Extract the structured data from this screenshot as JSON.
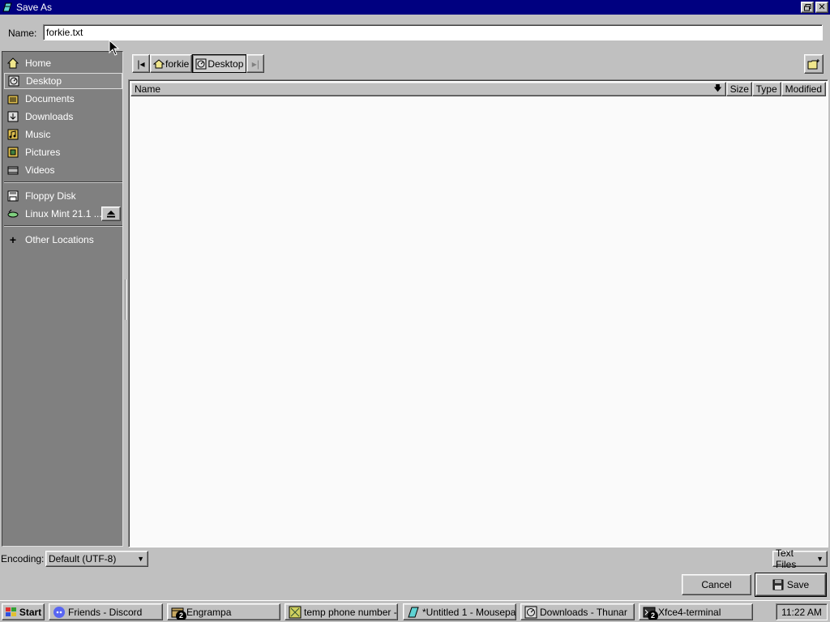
{
  "window": {
    "title": "Save As",
    "icon": "mousepad-icon"
  },
  "name_field": {
    "label": "Name:",
    "value": "forkie.txt"
  },
  "sidebar": {
    "items": [
      {
        "label": "Home",
        "icon": "home-icon",
        "selected": false
      },
      {
        "label": "Desktop",
        "icon": "desktop-icon",
        "selected": true
      },
      {
        "label": "Documents",
        "icon": "documents-icon",
        "selected": false
      },
      {
        "label": "Downloads",
        "icon": "downloads-icon",
        "selected": false
      },
      {
        "label": "Music",
        "icon": "music-icon",
        "selected": false
      },
      {
        "label": "Pictures",
        "icon": "pictures-icon",
        "selected": false
      },
      {
        "label": "Videos",
        "icon": "videos-icon",
        "selected": false
      }
    ],
    "devices": [
      {
        "label": "Floppy Disk",
        "icon": "floppy-disk-icon"
      },
      {
        "label": "Linux Mint 21.1 ...",
        "icon": "drive-icon"
      }
    ],
    "other": {
      "label": "Other Locations",
      "icon": "plus-icon"
    }
  },
  "path_bar": {
    "segments": [
      {
        "label": "forkie",
        "icon": "home-folder-icon",
        "active": false
      },
      {
        "label": "Desktop",
        "icon": "desktop-icon",
        "active": true
      }
    ]
  },
  "file_list": {
    "columns": {
      "name": "Name",
      "size": "Size",
      "type": "Type",
      "modified": "Modified"
    },
    "rows": []
  },
  "encoding": {
    "label": "Encoding:",
    "value": "Default (UTF-8)"
  },
  "filter": {
    "value": "Text Files"
  },
  "buttons": {
    "cancel": "Cancel",
    "save": "Save"
  },
  "taskbar": {
    "start_label": "Start",
    "tasks": [
      {
        "label": "Friends - Discord",
        "icon": "discord-icon",
        "badge": ""
      },
      {
        "label": "Engrampa",
        "icon": "archive-icon",
        "badge": "2"
      },
      {
        "label": "temp phone number - ...",
        "icon": "browser-icon",
        "badge": ""
      },
      {
        "label": "*Untitled 1 - Mousepad",
        "icon": "mousepad-icon",
        "badge": ""
      },
      {
        "label": "Downloads - Thunar",
        "icon": "thunar-icon",
        "badge": ""
      },
      {
        "label": "Xfce4-terminal",
        "icon": "terminal-icon",
        "badge": "2"
      }
    ],
    "clock": "11:22 AM"
  },
  "colors": {
    "titlebar": "#000080",
    "sidebar": "#808080",
    "face": "#c0c0c0"
  }
}
